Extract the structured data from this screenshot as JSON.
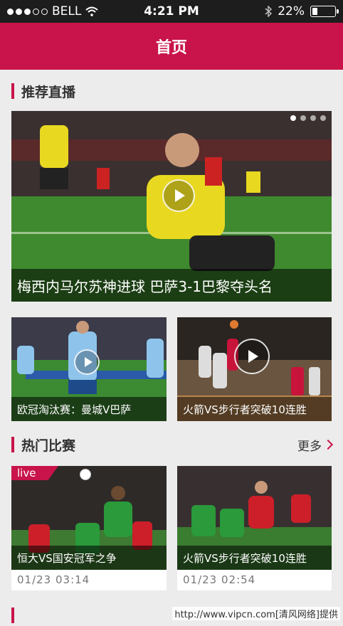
{
  "status_bar": {
    "carrier": "BELL",
    "time": "4:21 PM",
    "battery": "22%",
    "battery_level": 0.22,
    "signal_bars_filled": 3,
    "signal_bars_total": 5
  },
  "nav": {
    "title": "首页"
  },
  "recommended": {
    "title": "推荐直播",
    "featured": {
      "caption": "梅西内马尔苏神进球 巴萨3-1巴黎夺头名",
      "pages_total": 4,
      "active_page": 1
    },
    "cards": [
      {
        "caption": "欧冠淘汰赛：曼城V巴萨"
      },
      {
        "caption": "火箭VS步行者突破10连胜"
      }
    ]
  },
  "hot": {
    "title": "热门比赛",
    "more": "更多",
    "matches": [
      {
        "caption": "恒大VS国安冠军之争",
        "time": "01/23  03:14",
        "live": "live"
      },
      {
        "caption": "火箭VS步行者突破10连胜",
        "time": "01/23  02:54"
      }
    ]
  },
  "watermark": "http://www.vipcn.com[清风网络]提供",
  "colors": {
    "accent": "#c8144a",
    "background": "#ececec",
    "status_bar": "#1d1d1d"
  }
}
